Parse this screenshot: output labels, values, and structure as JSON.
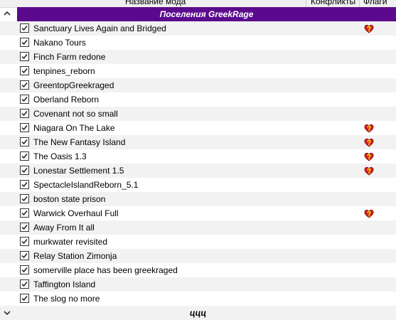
{
  "header": {
    "columns": [
      {
        "label": "Название мода"
      },
      {
        "label": "Конфликты"
      },
      {
        "label": "Флаги"
      }
    ]
  },
  "groups": [
    {
      "title": "Поселения GreekRage",
      "expanded": true
    },
    {
      "title": "ццц",
      "expanded": false
    }
  ],
  "mods": [
    {
      "name": "Sanctuary Lives Again and Bridged",
      "checked": true,
      "flag": true
    },
    {
      "name": "Nakano Tours",
      "checked": true,
      "flag": false
    },
    {
      "name": "Finch Farm redone",
      "checked": true,
      "flag": false
    },
    {
      "name": "tenpines_reborn",
      "checked": true,
      "flag": false
    },
    {
      "name": "GreentopGreekraged",
      "checked": true,
      "flag": false
    },
    {
      "name": "Oberland Reborn",
      "checked": true,
      "flag": false
    },
    {
      "name": "Covenant not so small",
      "checked": true,
      "flag": false
    },
    {
      "name": "Niagara On The Lake",
      "checked": true,
      "flag": true
    },
    {
      "name": "The New Fantasy Island",
      "checked": true,
      "flag": true
    },
    {
      "name": "The Oasis 1.3",
      "checked": true,
      "flag": true
    },
    {
      "name": "Lonestar Settlement 1.5",
      "checked": true,
      "flag": true
    },
    {
      "name": "SpectacleIslandReborn_5.1",
      "checked": true,
      "flag": false
    },
    {
      "name": "boston state prison",
      "checked": true,
      "flag": false
    },
    {
      "name": "Warwick Overhaul Full",
      "checked": true,
      "flag": true
    },
    {
      "name": "Away From It all",
      "checked": true,
      "flag": false
    },
    {
      "name": "murkwater revisited",
      "checked": true,
      "flag": false
    },
    {
      "name": "Relay Station Zimonja",
      "checked": true,
      "flag": false
    },
    {
      "name": "somerville place has been greekraged",
      "checked": true,
      "flag": false
    },
    {
      "name": "Taffington Island",
      "checked": true,
      "flag": false
    },
    {
      "name": "The slog no more",
      "checked": true,
      "flag": false
    }
  ],
  "icons": {
    "chevron": "chevron-down-icon",
    "checkbox": "checkbox-checked-icon",
    "flag": "heart-question-flag-icon"
  },
  "colors": {
    "group_band": "#5b0a8e",
    "group_text": "#ffffff",
    "row_alt": "#f2f2f2",
    "flag_red": "#d21e1e",
    "flag_yellow": "#f2d21a"
  }
}
